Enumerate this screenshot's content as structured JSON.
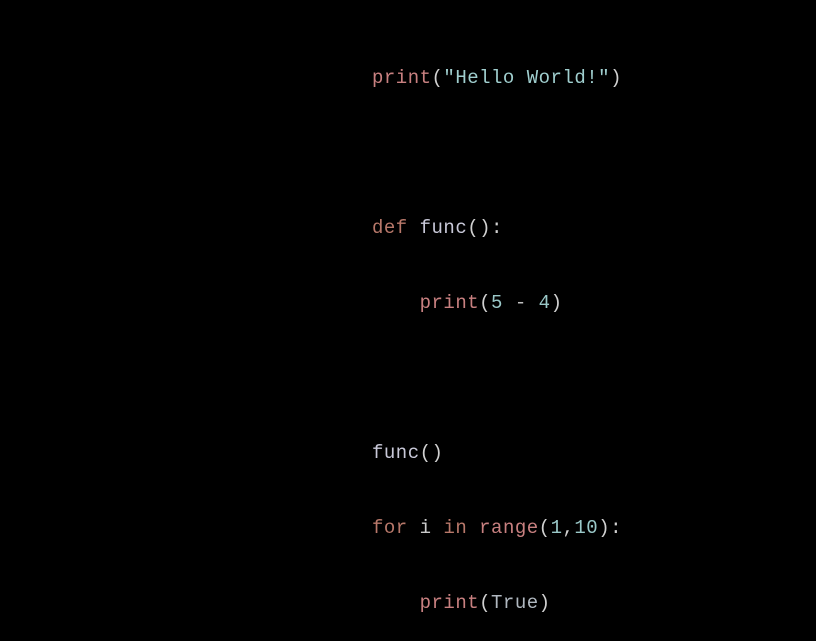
{
  "code": {
    "line1": {
      "print": "print",
      "lparen": "(",
      "str": "\"Hello World!\"",
      "rparen": ")"
    },
    "line3": {
      "def": "def",
      "sp1": " ",
      "name": "func",
      "parens": "()",
      "colon": ":"
    },
    "line4": {
      "indent": "    ",
      "print": "print",
      "lparen": "(",
      "num1": "5",
      "sp1": " ",
      "op": "-",
      "sp2": " ",
      "num2": "4",
      "rparen": ")"
    },
    "line6": {
      "name": "func",
      "parens": "()"
    },
    "line7": {
      "for": "for",
      "sp1": " ",
      "var": "i",
      "sp2": " ",
      "in": "in",
      "sp3": " ",
      "range": "range",
      "lparen": "(",
      "num1": "1",
      "comma": ",",
      "num2": "10",
      "rparen": ")",
      "colon": ":"
    },
    "line8": {
      "indent": "    ",
      "print": "print",
      "lparen": "(",
      "const": "True",
      "rparen": ")"
    }
  }
}
